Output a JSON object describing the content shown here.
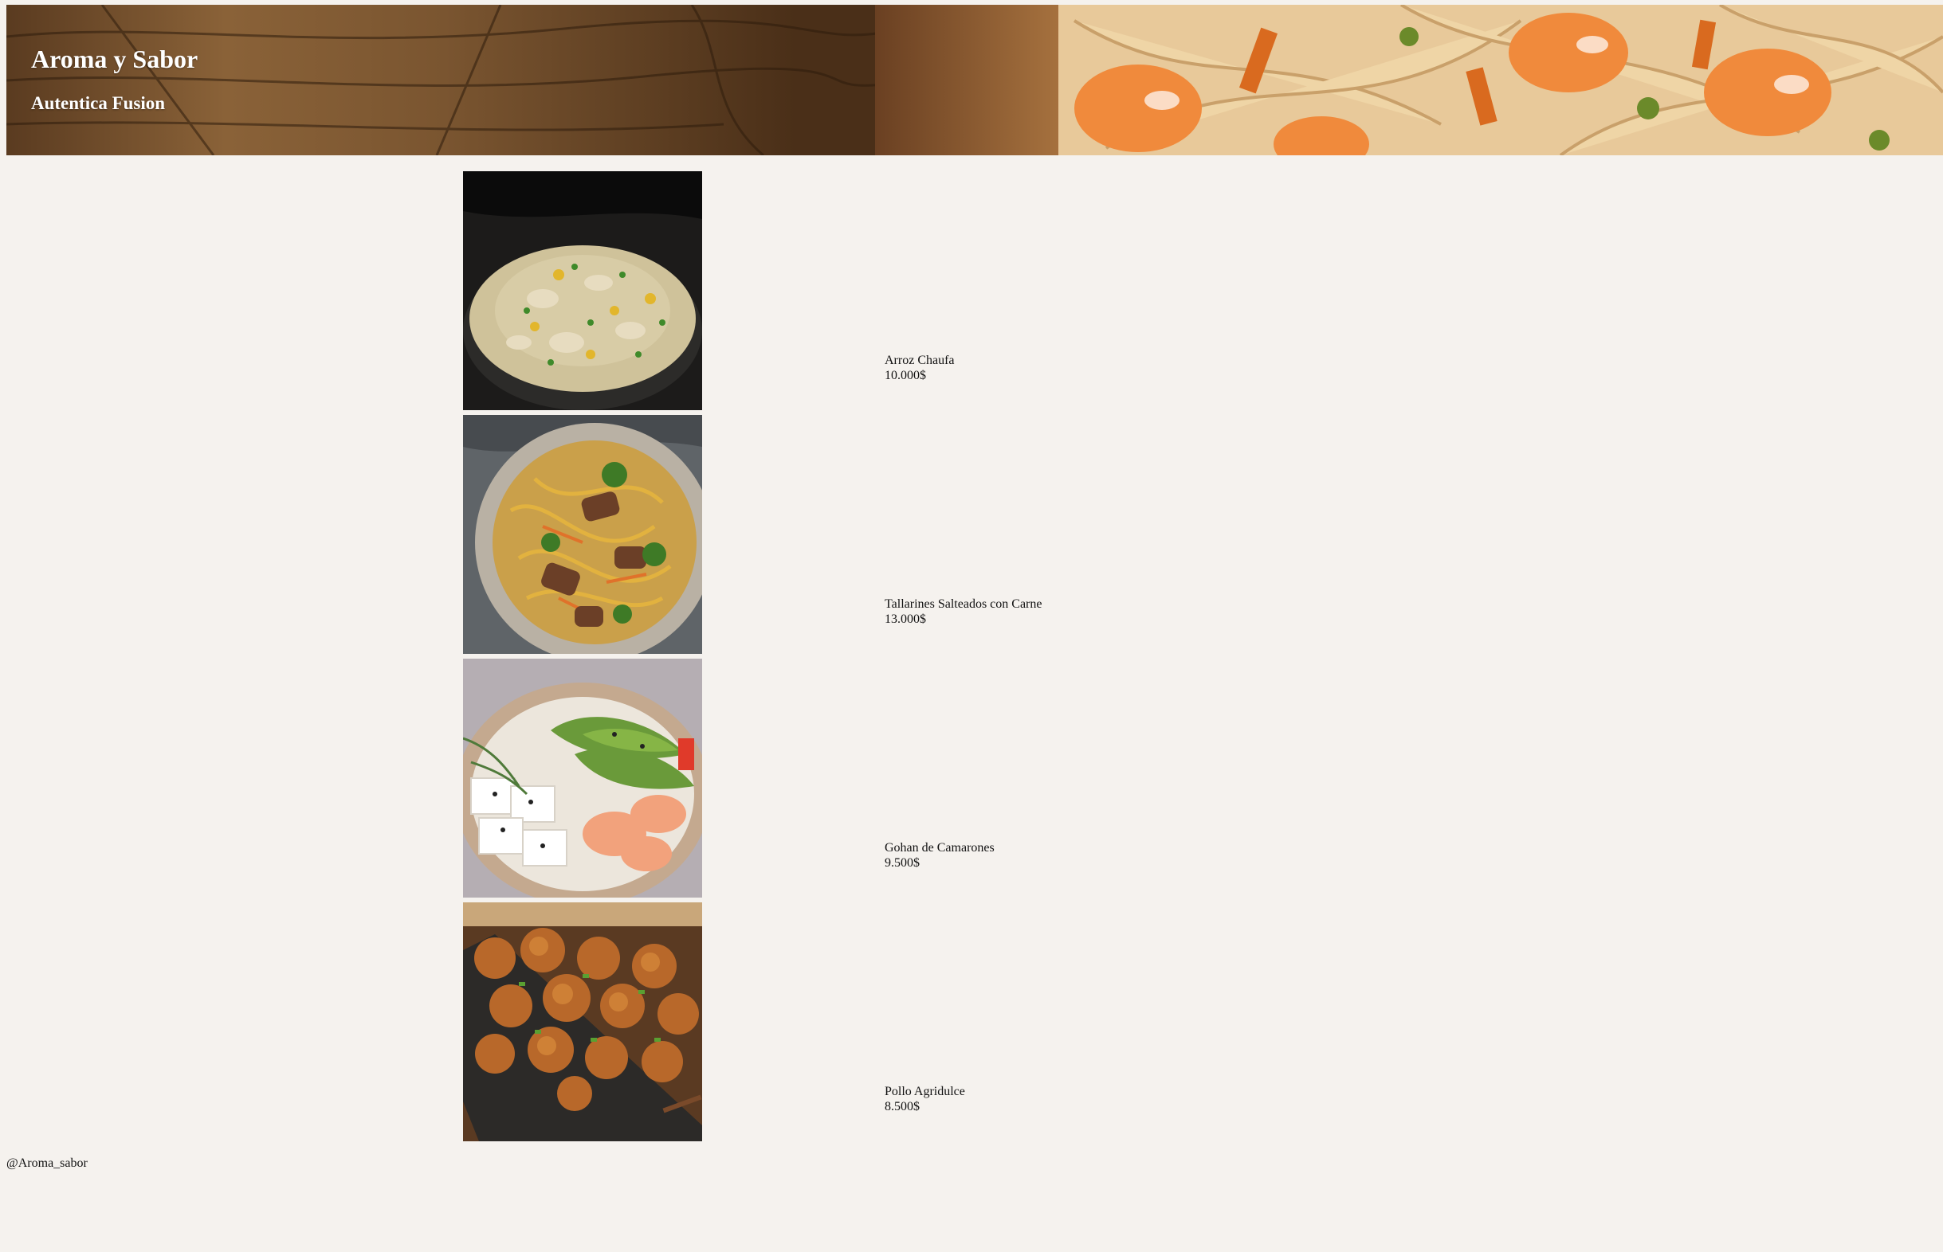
{
  "header": {
    "title": "Aroma y Sabor",
    "subtitle": "Autentica Fusion"
  },
  "menu": {
    "items": [
      {
        "name": "Arroz Chaufa",
        "price": "10.000$",
        "image": "fried-rice-photo"
      },
      {
        "name": "Tallarines Salteados con Carne",
        "price": "13.000$",
        "image": "stir-fried-noodles-photo"
      },
      {
        "name": "Gohan de Camarones",
        "price": "9.500$",
        "image": "shrimp-rice-bowl-photo"
      },
      {
        "name": "Pollo Agridulce",
        "price": "8.500$",
        "image": "sweet-sour-chicken-photo"
      }
    ]
  },
  "footer": {
    "handle": "@Aroma_sabor"
  }
}
